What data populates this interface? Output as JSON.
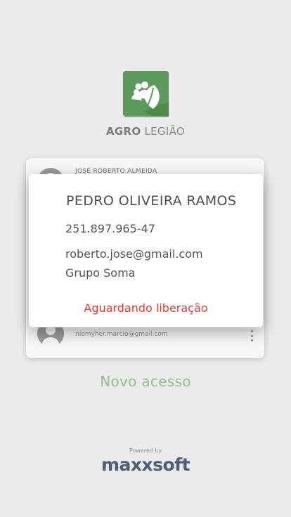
{
  "brand": {
    "bold": "AGRO",
    "light": "LEGIÃO"
  },
  "logo": {
    "icon": "leaf-people-icon",
    "color": "#5b9a5a"
  },
  "accounts": [
    {
      "name": "JOSÉ ROBERTO ALMEIDA",
      "email": ""
    },
    {
      "name": "",
      "email": "niemyher.marcio@gmail.com"
    }
  ],
  "selected_account": {
    "name": "PEDRO OLIVEIRA RAMOS",
    "cpf": "251.897.965-47",
    "email": "roberto.jose@gmail.com",
    "group": "Grupo Soma",
    "status": "Aguardando liberação",
    "status_color": "#d4403a"
  },
  "new_access_label": "Novo acesso",
  "footer": {
    "powered_by": "Powered by",
    "company": "maxxsoft"
  }
}
